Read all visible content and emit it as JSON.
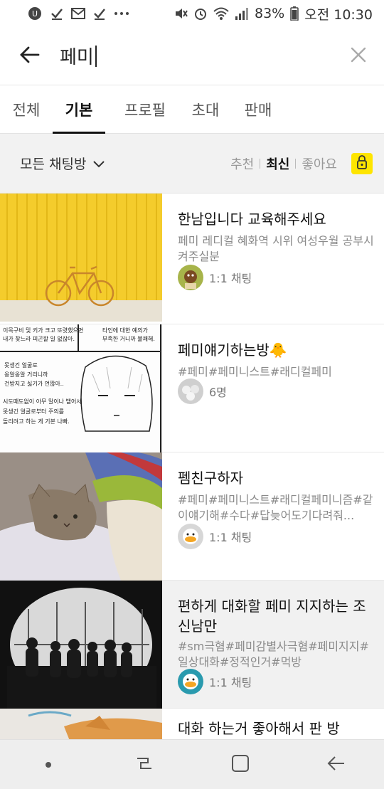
{
  "status_bar": {
    "left_icons": [
      "talk-icon",
      "check-icon",
      "gmail-icon",
      "check-icon",
      "more-dots-icon"
    ],
    "battery": "83%",
    "time": "오전 10:30"
  },
  "search": {
    "query": "페미"
  },
  "tabs": [
    {
      "label": "전체",
      "active": false
    },
    {
      "label": "기본",
      "active": true
    },
    {
      "label": "프로필",
      "active": false
    },
    {
      "label": "초대",
      "active": false
    },
    {
      "label": "판매",
      "active": false
    }
  ],
  "filter": {
    "dropdown_label": "모든 채팅방",
    "sort": [
      "추천",
      "최신",
      "좋아요"
    ],
    "sort_active": "최신"
  },
  "rooms": [
    {
      "title": "한남입니다 교육해주세요",
      "desc": "페미 레디컬 혜화역 시위 여성우월 공부시켜주실분",
      "meta": "1:1 채팅",
      "thumb": "yellow-wall-bicycle",
      "avatar": "green-character"
    },
    {
      "title": "페미얘기하는방🐥",
      "desc": "#페미#페미니스트#래디컬페미",
      "meta": "6명",
      "thumb": "comic-panel",
      "avatar": "group-photo",
      "comic_lines": [
        "이목구비 및 키가 크고 또렷했으면",
        "내가 찾느라 피곤할 일 없잖아.",
        "타인에 대한 예의가",
        "부족한 거니까 불쾌해.",
        "못생긴 얼굴로",
        "옹알옹알 거리니까",
        "건방지고 싫기가 언짢아..",
        "시도때도없이 아무 말이나 뱉어서",
        "못생긴 얼굴로부터 주의를",
        "돌리려고 하는 게 기본 나빠."
      ]
    },
    {
      "title": "펨친구하자",
      "desc": "#페미#페미니스트#래디컬페미니즘#같이얘기해#수다#답늦어도기다려줘...",
      "meta": "1:1 채팅",
      "thumb": "cat-blanket",
      "avatar": "duck-character"
    },
    {
      "title": "편하게 대화할 페미 지지하는 조신남만",
      "desc": "#sm극혐#페미감별사극혐#페미지지#일상대화#정적인거#먹방",
      "meta": "1:1 채팅",
      "thumb": "silhouettes-window",
      "avatar": "duck-teal"
    },
    {
      "title": "대화 하는거 좋아해서 판 방",
      "desc": "",
      "meta": "",
      "thumb": "orange-cat",
      "avatar": ""
    }
  ],
  "nav": [
    "recent-dot-icon",
    "recents-icon",
    "home-icon",
    "back-icon"
  ],
  "colors": {
    "accent_yellow": "#fee500",
    "highlight_row": "#f1f1f1"
  }
}
